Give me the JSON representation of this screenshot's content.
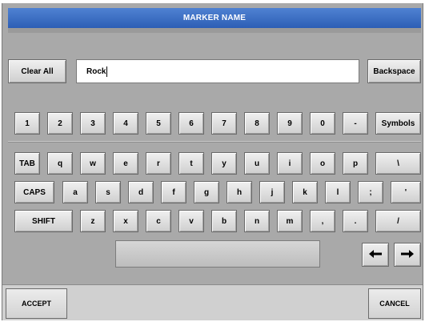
{
  "title": "MARKER NAME",
  "input": {
    "value": "Rock"
  },
  "controls": {
    "clear_all": "Clear All",
    "backspace": "Backspace"
  },
  "keyboard": {
    "number_row": [
      "1",
      "2",
      "3",
      "4",
      "5",
      "6",
      "7",
      "8",
      "9",
      "0",
      "-",
      "Symbols"
    ],
    "row_q": [
      "TAB",
      "q",
      "w",
      "e",
      "r",
      "t",
      "y",
      "u",
      "i",
      "o",
      "p",
      "\\"
    ],
    "row_a": [
      "CAPS",
      "a",
      "s",
      "d",
      "f",
      "g",
      "h",
      "j",
      "k",
      "l",
      ";",
      "'"
    ],
    "row_z": [
      "SHIFT",
      "z",
      "x",
      "c",
      "v",
      "b",
      "n",
      "m",
      ",",
      ".",
      "/"
    ],
    "left_arrow_icon": "arrow-left-icon",
    "right_arrow_icon": "arrow-right-icon"
  },
  "footer": {
    "accept": "ACCEPT",
    "cancel": "CANCEL"
  },
  "colors": {
    "title_bar": "#3a6cc4",
    "panel": "#a9a9a9",
    "key_face": "#e2e2e2",
    "footer": "#d0d0d0"
  }
}
